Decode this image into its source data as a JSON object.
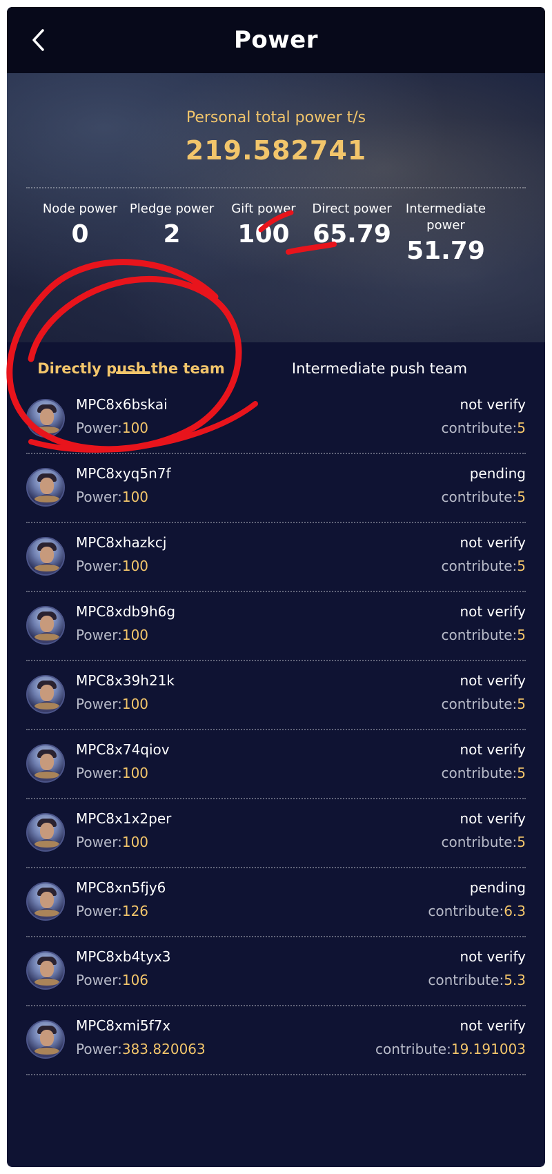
{
  "header": {
    "title": "Power",
    "back_icon": "chevron-left-icon"
  },
  "hero": {
    "label": "Personal total power t/s",
    "value": "219.582741",
    "stats": [
      {
        "label": "Node power",
        "value": "0"
      },
      {
        "label": "Pledge power",
        "value": "2"
      },
      {
        "label": "Gift power",
        "value": "100"
      },
      {
        "label": "Direct power",
        "value": "65.79"
      },
      {
        "label": "Intermediate power",
        "value": "51.79"
      }
    ]
  },
  "tabs": [
    {
      "label": "Directly push the team",
      "active": true
    },
    {
      "label": "Intermediate push team",
      "active": false
    }
  ],
  "list_labels": {
    "power_prefix": "Power:",
    "contribute_prefix": "contribute:"
  },
  "members": [
    {
      "name": "MPC8x6bskai",
      "power": "100",
      "status": "not verify",
      "contribute": "5"
    },
    {
      "name": "MPC8xyq5n7f",
      "power": "100",
      "status": "pending",
      "contribute": "5"
    },
    {
      "name": "MPC8xhazkcj",
      "power": "100",
      "status": "not verify",
      "contribute": "5"
    },
    {
      "name": "MPC8xdb9h6g",
      "power": "100",
      "status": "not verify",
      "contribute": "5"
    },
    {
      "name": "MPC8x39h21k",
      "power": "100",
      "status": "not verify",
      "contribute": "5"
    },
    {
      "name": "MPC8x74qiov",
      "power": "100",
      "status": "not verify",
      "contribute": "5"
    },
    {
      "name": "MPC8x1x2per",
      "power": "100",
      "status": "not verify",
      "contribute": "5"
    },
    {
      "name": "MPC8xn5fjy6",
      "power": "126",
      "status": "pending",
      "contribute": "6.3"
    },
    {
      "name": "MPC8xb4tyx3",
      "power": "106",
      "status": "not verify",
      "contribute": "5.3"
    },
    {
      "name": "MPC8xmi5f7x",
      "power": "383.820063",
      "status": "not verify",
      "contribute": "19.191003"
    }
  ],
  "colors": {
    "accent": "#f2c56b",
    "background": "#0f1333",
    "header": "#07091a",
    "annotation": "#e8141c"
  }
}
